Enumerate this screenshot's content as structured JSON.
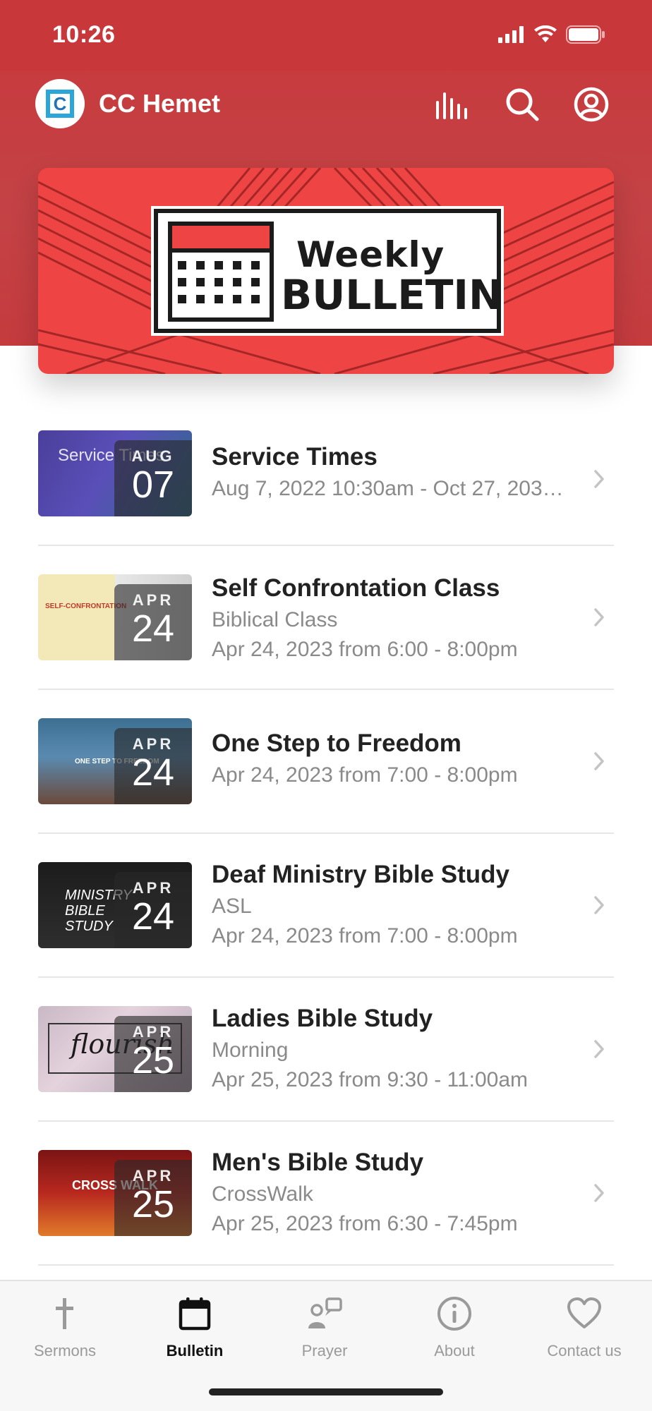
{
  "status_bar": {
    "time": "10:26"
  },
  "header": {
    "title": "CC Hemet",
    "logo_letter": "C"
  },
  "banner": {
    "line1": "Weekly",
    "line2": "BULLETIN"
  },
  "events": [
    {
      "title": "Service Times",
      "subtitle": "",
      "date": "Aug 7, 2022 10:30am - Oct 27, 203…",
      "month": "AUG",
      "day": "07",
      "thumb_text": "Service Times"
    },
    {
      "title": "Self Confrontation Class",
      "subtitle": "Biblical Class",
      "date": "Apr 24, 2023 from 6:00 - 8:00pm",
      "month": "APR",
      "day": "24",
      "thumb_text": "SELF-CONFRONTATION"
    },
    {
      "title": "One Step to Freedom",
      "subtitle": "",
      "date": "Apr 24, 2023 from 7:00 - 8:00pm",
      "month": "APR",
      "day": "24",
      "thumb_text": "ONE STEP TO FREEDOM"
    },
    {
      "title": "Deaf Ministry Bible Study",
      "subtitle": "ASL",
      "date": "Apr 24, 2023 from 7:00 - 8:00pm",
      "month": "APR",
      "day": "24",
      "thumb_text": "MINISTRY BIBLE STUDY"
    },
    {
      "title": "Ladies Bible Study",
      "subtitle": "Morning",
      "date": "Apr 25, 2023 from 9:30 - 11:00am",
      "month": "APR",
      "day": "25",
      "thumb_text": "flourish"
    },
    {
      "title": "Men's Bible Study",
      "subtitle": "CrossWalk",
      "date": "Apr 25, 2023 from 6:30 - 7:45pm",
      "month": "APR",
      "day": "25",
      "thumb_text": "CROSS WALK"
    }
  ],
  "tabs": [
    {
      "label": "Sermons",
      "icon": "cross-icon"
    },
    {
      "label": "Bulletin",
      "icon": "calendar-icon",
      "active": true
    },
    {
      "label": "Prayer",
      "icon": "prayer-icon"
    },
    {
      "label": "About",
      "icon": "info-icon"
    },
    {
      "label": "Contact us",
      "icon": "heart-icon"
    }
  ],
  "colors": {
    "brand_red": "#c8373a",
    "banner_red": "#ef4444",
    "accent_blue": "#2aa6d9"
  }
}
